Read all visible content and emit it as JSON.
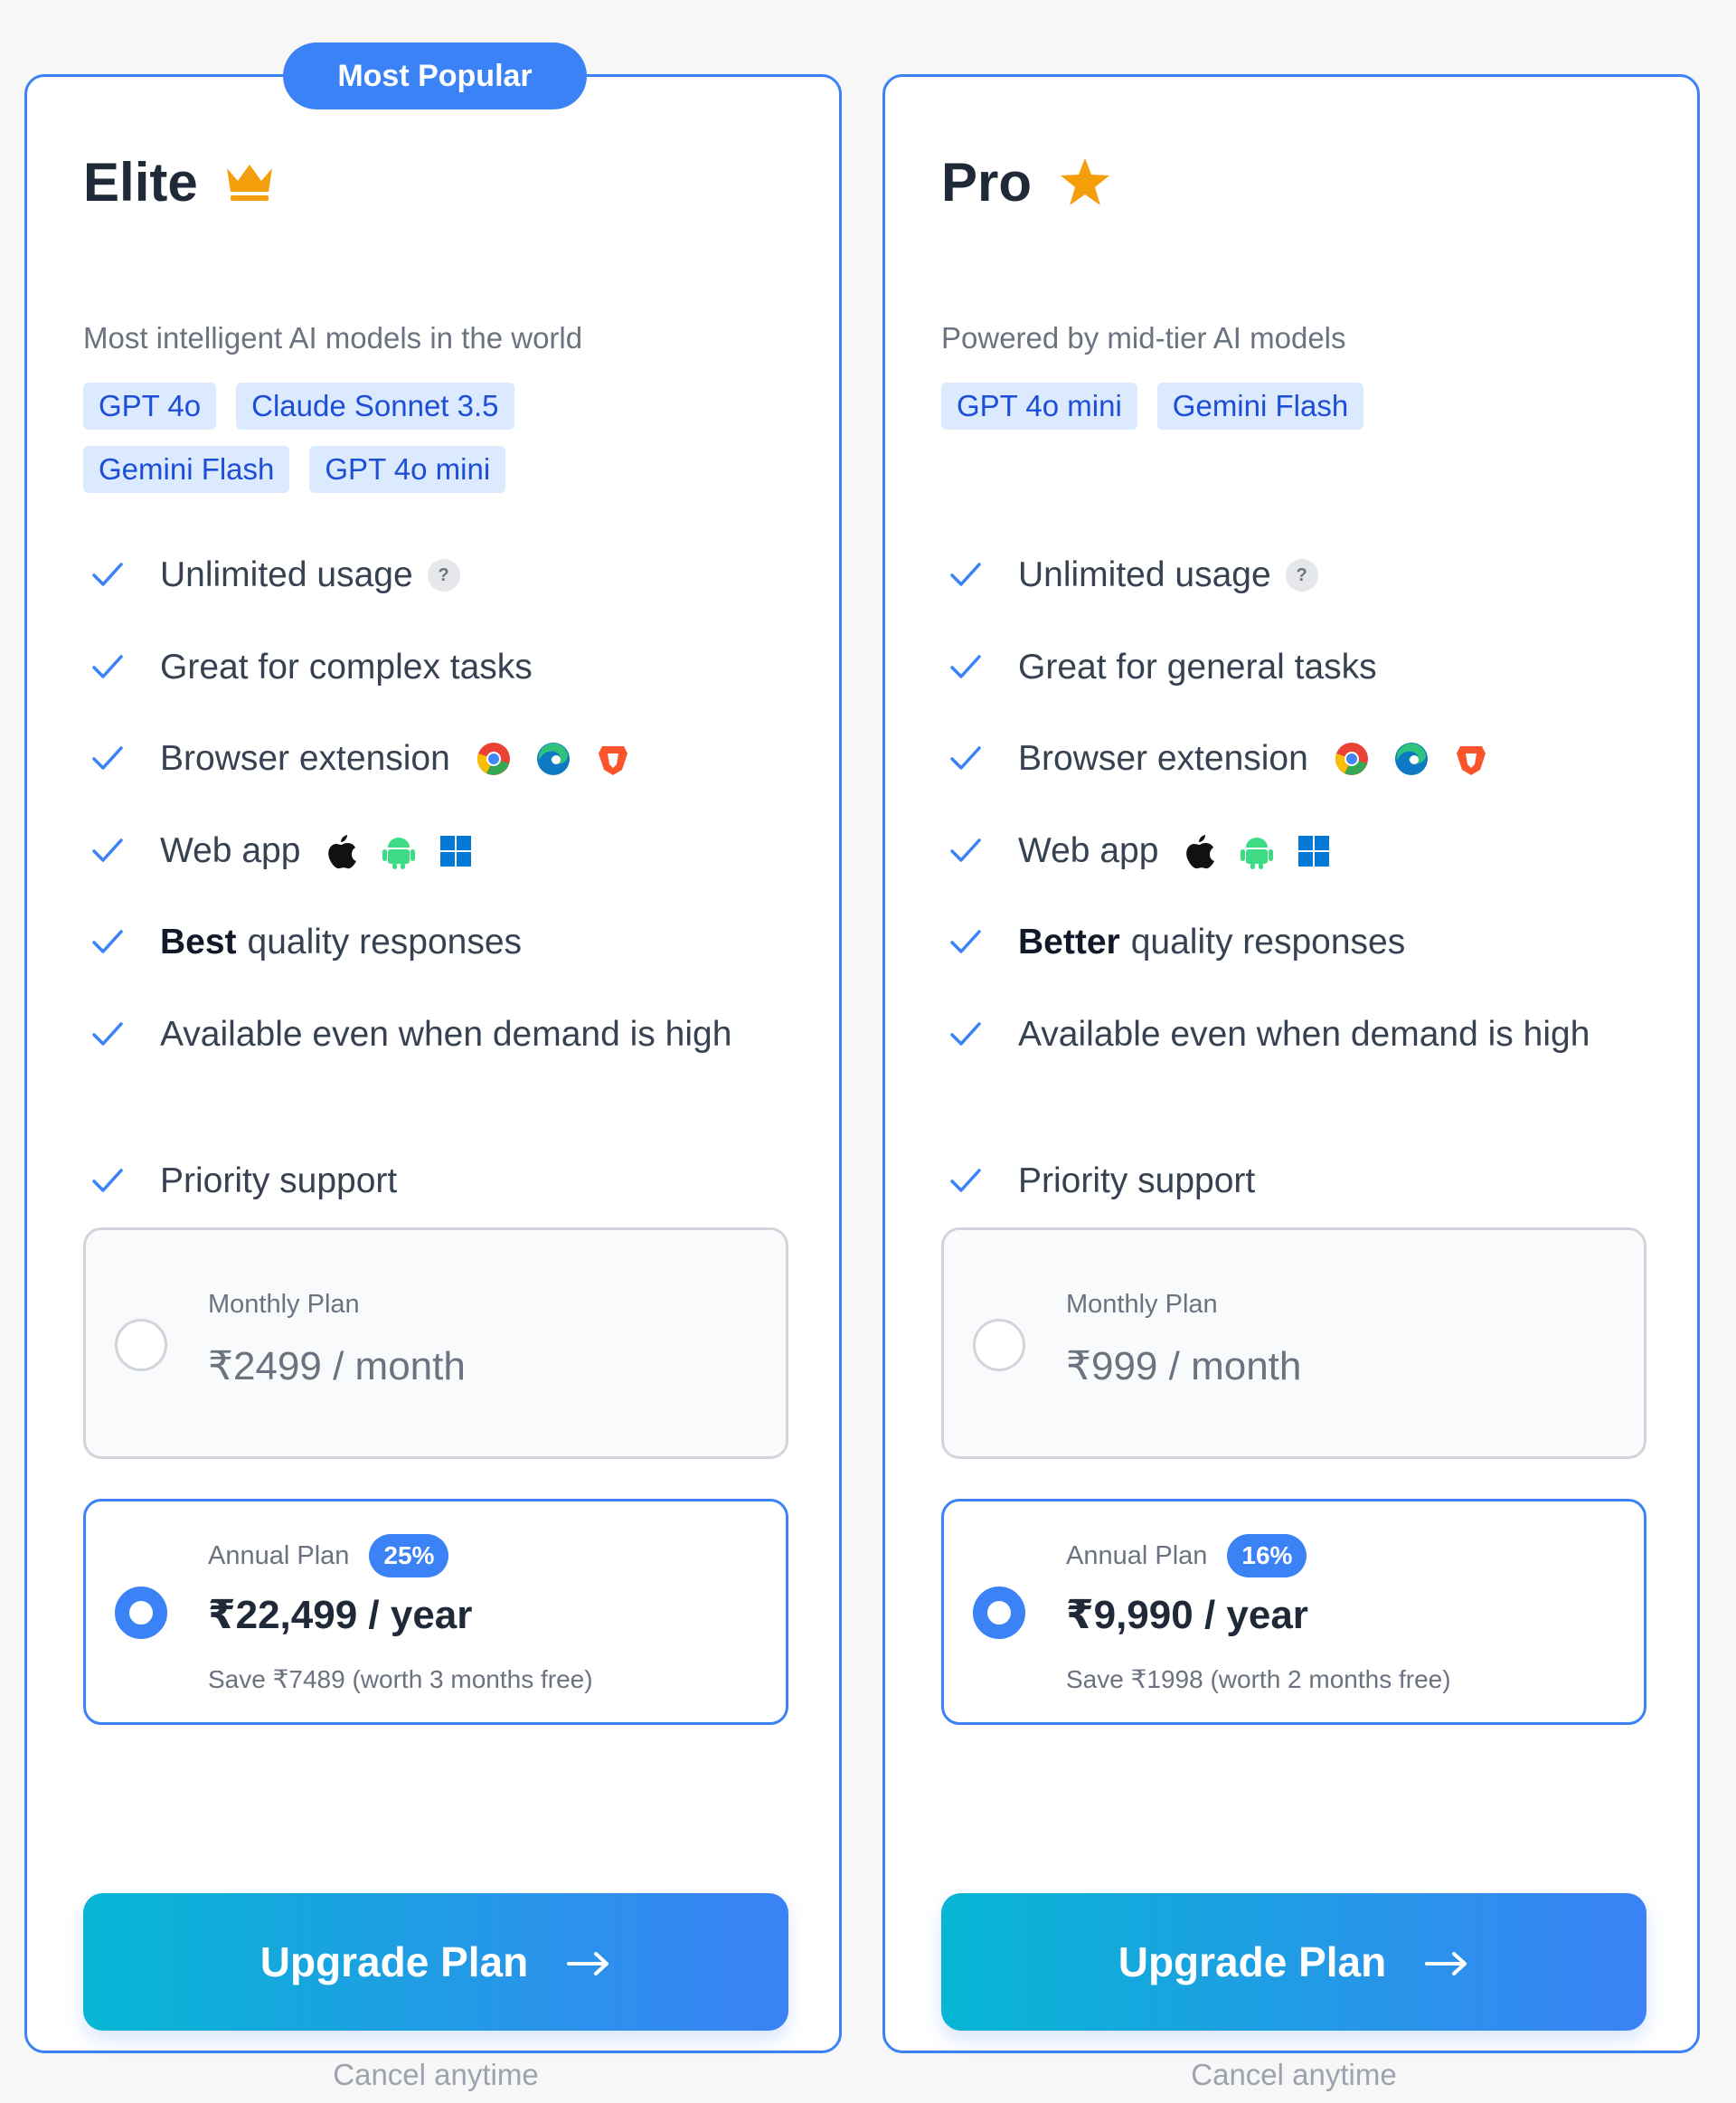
{
  "colors": {
    "accent": "#3b82f6",
    "chip_bg": "#dbeafe",
    "chip_text": "#1d4ed8",
    "gradient_start": "#06b6d4",
    "gradient_end": "#3b82f6",
    "crown": "#f59e0b",
    "star": "#f59e0b"
  },
  "plans": [
    {
      "badge": "Most Popular",
      "title": "Elite",
      "title_icon": "crown-icon",
      "subtitle": "Most intelligent AI models in the world",
      "models": [
        "GPT 4o",
        "Claude Sonnet 3.5",
        "Gemini Flash",
        "GPT 4o mini"
      ],
      "features": {
        "unlimited": "Unlimited usage",
        "help_mark": "?",
        "tasks": "Great for complex tasks",
        "extension": "Browser extension",
        "extension_icons": [
          "chrome-icon",
          "edge-icon",
          "brave-icon"
        ],
        "webapp": "Web app",
        "webapp_icons": [
          "apple-icon",
          "android-icon",
          "windows-icon"
        ],
        "quality_bold": "Best",
        "quality_rest": "quality responses",
        "availability": "Available even when demand is high",
        "support": "Priority support"
      },
      "monthly": {
        "label": "Monthly Plan",
        "price": "₹2499 / month",
        "selected": false
      },
      "annual": {
        "label": "Annual Plan",
        "discount": "25%",
        "price": "₹22,499 / year",
        "save": "Save ₹7489 (worth 3 months free)",
        "selected": true
      },
      "cta": "Upgrade Plan",
      "cta_icon": "arrow-right-icon",
      "cancel": "Cancel anytime"
    },
    {
      "title": "Pro",
      "title_icon": "star-icon",
      "subtitle": "Powered by mid-tier AI models",
      "models": [
        "GPT 4o mini",
        "Gemini Flash"
      ],
      "features": {
        "unlimited": "Unlimited usage",
        "help_mark": "?",
        "tasks": "Great for general tasks",
        "extension": "Browser extension",
        "extension_icons": [
          "chrome-icon",
          "edge-icon",
          "brave-icon"
        ],
        "webapp": "Web app",
        "webapp_icons": [
          "apple-icon",
          "android-icon",
          "windows-icon"
        ],
        "quality_bold": "Better",
        "quality_rest": "quality responses",
        "availability": "Available even when demand is high",
        "support": "Priority support"
      },
      "monthly": {
        "label": "Monthly Plan",
        "price": "₹999 / month",
        "selected": false
      },
      "annual": {
        "label": "Annual Plan",
        "discount": "16%",
        "price": "₹9,990 / year",
        "save": "Save ₹1998 (worth 2 months free)",
        "selected": true
      },
      "cta": "Upgrade Plan",
      "cta_icon": "arrow-right-icon",
      "cancel": "Cancel anytime"
    }
  ]
}
